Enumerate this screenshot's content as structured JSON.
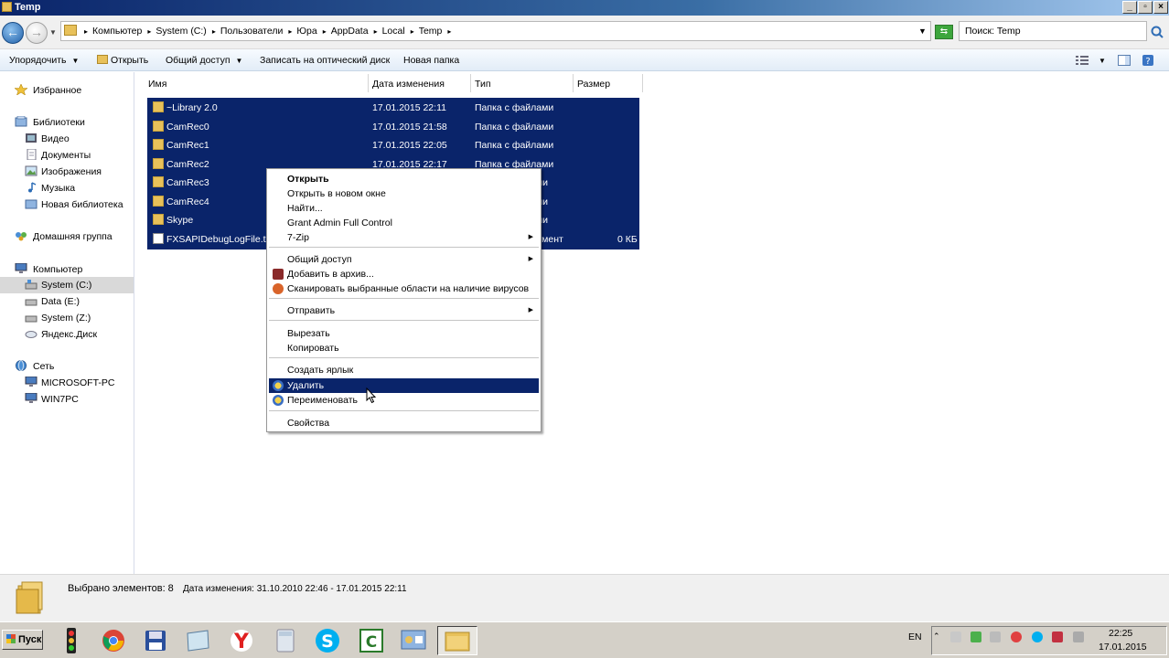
{
  "window": {
    "title": "Temp",
    "buttons": {
      "minimize": "_",
      "maximize": "▫",
      "close": "×"
    }
  },
  "address": {
    "crumbs": [
      "Компьютер",
      "System (C:)",
      "Пользователи",
      "Юра",
      "AppData",
      "Local",
      "Temp"
    ],
    "search_placeholder": "Поиск: Temp"
  },
  "toolbar": {
    "organize": "Упорядочить",
    "open": "Открыть",
    "share": "Общий доступ",
    "burn": "Записать на оптический диск",
    "new_folder": "Новая папка"
  },
  "navpane": {
    "favorites": "Избранное",
    "libraries": "Библиотеки",
    "lib_items": [
      "Видео",
      "Документы",
      "Изображения",
      "Музыка",
      "Новая библиотека"
    ],
    "homegroup": "Домашняя группа",
    "computer": "Компьютер",
    "drives": [
      "System (C:)",
      "Data (E:)",
      "System (Z:)",
      "Яндекс.Диск"
    ],
    "network": "Сеть",
    "net_items": [
      "MICROSOFT-PC",
      "WIN7PC"
    ]
  },
  "columns": {
    "name": "Имя",
    "date": "Дата изменения",
    "type": "Тип",
    "size": "Размер"
  },
  "files": [
    {
      "name": "~Library 2.0",
      "date": "17.01.2015 22:11",
      "type": "Папка с файлами",
      "size": "",
      "kind": "folder"
    },
    {
      "name": "CamRec0",
      "date": "17.01.2015 21:58",
      "type": "Папка с файлами",
      "size": "",
      "kind": "folder"
    },
    {
      "name": "CamRec1",
      "date": "17.01.2015 22:05",
      "type": "Папка с файлами",
      "size": "",
      "kind": "folder"
    },
    {
      "name": "CamRec2",
      "date": "17.01.2015 22:17",
      "type": "Папка с файлами",
      "size": "",
      "kind": "folder"
    },
    {
      "name": "CamRec3",
      "date": "",
      "type": "ли",
      "size": "",
      "kind": "folder"
    },
    {
      "name": "CamRec4",
      "date": "",
      "type": "ли",
      "size": "",
      "kind": "folder"
    },
    {
      "name": "Skype",
      "date": "",
      "type": "ли",
      "size": "",
      "kind": "folder"
    },
    {
      "name": "FXSAPIDebugLogFile.txt",
      "date": "",
      "type": "умент",
      "size": "0 КБ",
      "kind": "txt"
    }
  ],
  "context_menu": {
    "open": "Открыть",
    "open_new_window": "Открыть в новом окне",
    "find": "Найти...",
    "grant": "Grant Admin Full Control",
    "zip": "7-Zip",
    "share": "Общий доступ",
    "add_archive": "Добавить в архив...",
    "scan": "Сканировать выбранные области на наличие вирусов",
    "send_to": "Отправить",
    "cut": "Вырезать",
    "copy": "Копировать",
    "shortcut": "Создать ярлык",
    "delete": "Удалить",
    "rename": "Переименовать",
    "properties": "Свойства"
  },
  "status": {
    "selected": "Выбрано элементов: 8",
    "modified": "Дата изменения: 31.10.2010 22:46 - 17.01.2015 22:11"
  },
  "taskbar": {
    "start": "Пуск",
    "lang": "EN",
    "time": "22:25",
    "date": "17.01.2015"
  }
}
